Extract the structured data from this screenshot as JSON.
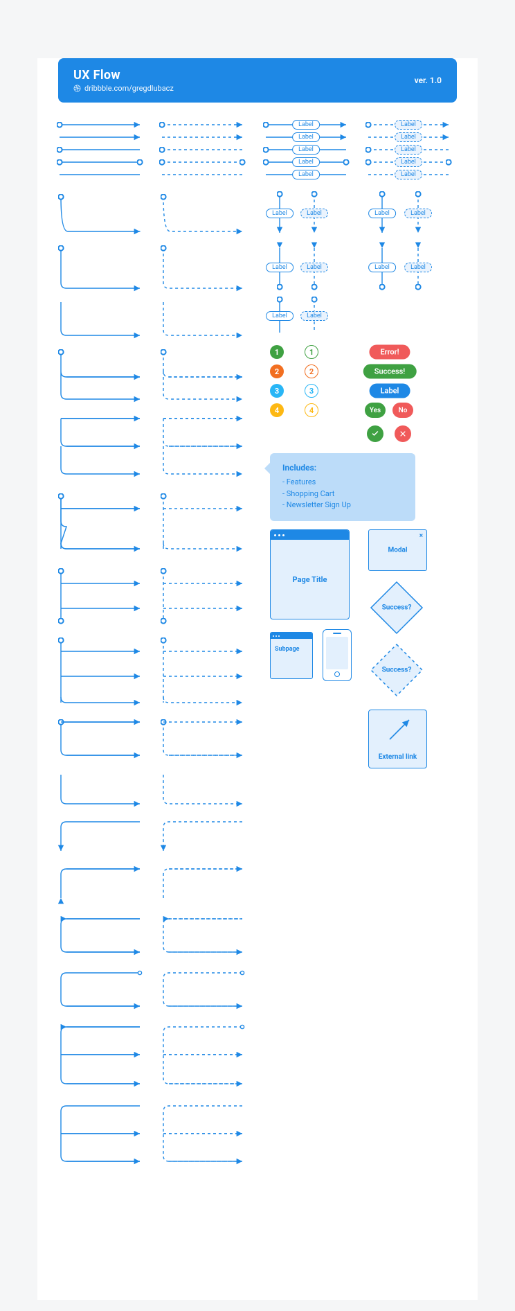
{
  "header": {
    "title": "UX Flow",
    "subtitle": "dribbble.com/gregdlubacz",
    "version": "ver. 1.0"
  },
  "connector_label": "Label",
  "numbers": [
    "1",
    "2",
    "3",
    "4"
  ],
  "number_colors_filled": [
    "#3fa142",
    "#f26f21",
    "#29b6f6",
    "#fdb813"
  ],
  "number_colors_outline": [
    "#3fa142",
    "#f26f21",
    "#29b6f6",
    "#fdb813"
  ],
  "status": {
    "error": {
      "text": "Error!",
      "bg": "#f05a5a"
    },
    "success": {
      "text": "Success!",
      "bg": "#3fa142"
    },
    "label": {
      "text": "Label",
      "bg": "#1e88e5"
    },
    "yes": {
      "text": "Yes",
      "bg": "#3fa142"
    },
    "no": {
      "text": "No",
      "bg": "#f05a5a"
    }
  },
  "callout": {
    "heading": "Includes:",
    "items": [
      "- Features",
      "- Shopping Cart",
      "- Newsletter Sign Up"
    ]
  },
  "wireframes": {
    "page": "Page Title",
    "subpage": "Subpage",
    "modal": "Modal",
    "decision": "Success?",
    "external": "External link"
  }
}
